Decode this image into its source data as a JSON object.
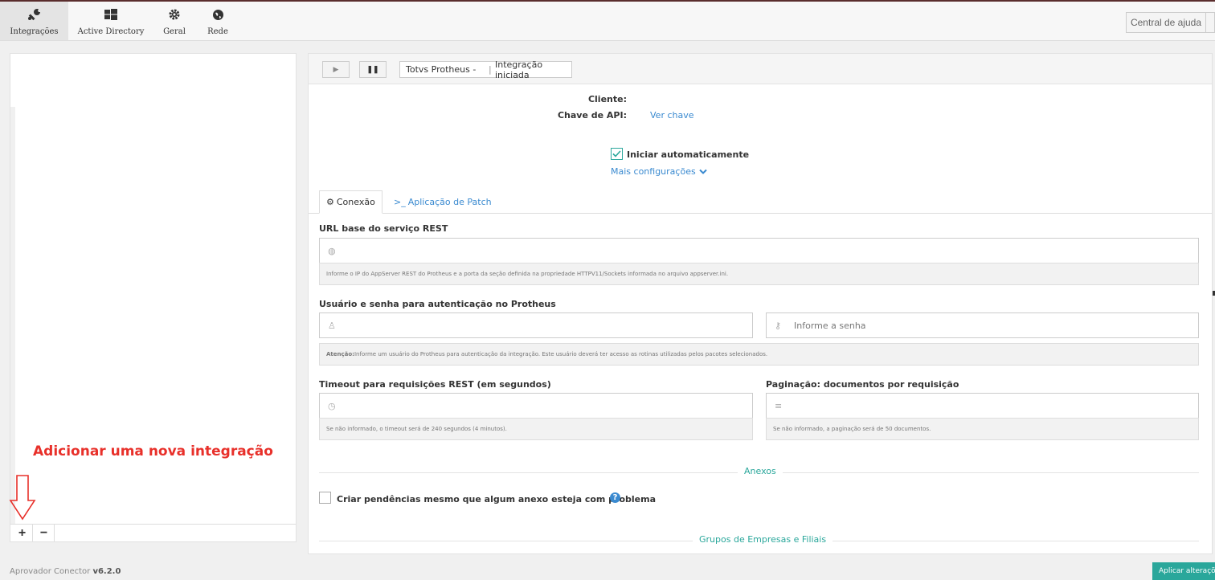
{
  "nav": {
    "tabs": [
      {
        "label": "Integrações",
        "icon": "wrench-icon"
      },
      {
        "label": "Active Directory",
        "icon": "windows-icon"
      },
      {
        "label": "Geral",
        "icon": "gear-icon"
      },
      {
        "label": "Rede",
        "icon": "globe-icon"
      }
    ],
    "active_tab": "Integrações",
    "help_label": "Central de ajuda"
  },
  "left_panel": {
    "annotation": "Adicionar uma nova integração",
    "add_label": "+",
    "remove_label": "−"
  },
  "toolbar": {
    "play_glyph": "▶",
    "pause_glyph": "❚❚",
    "integration_name": "Totvs Protheus -",
    "separator": "|",
    "status": "Integração iniciada"
  },
  "info": {
    "client_label": "Cliente:",
    "api_key_label": "Chave de API:",
    "api_key_link": "Ver chave",
    "auto_start_label": "Iniciar automaticamente",
    "more_settings": "Mais configurações"
  },
  "tabs": [
    {
      "label": "Conexão",
      "icon": "cogs-icon",
      "active": true
    },
    {
      "label": "Aplicação de Patch",
      "icon": "terminal-icon",
      "active": false
    }
  ],
  "form": {
    "url_title": "URL base do serviço REST",
    "url_hint": "Informe o IP do AppServer REST do Protheus e a porta da seção definida na propriedade HTTPV11/Sockets informada no arquivo appserver.ini.",
    "auth_title": "Usuário e senha para autenticação no Protheus",
    "password_placeholder": "Informe a senha",
    "auth_hint_bold": "Atenção:",
    "auth_hint": " Informe um usuário do Protheus para autenticação da integração. Este usuário deverá ter acesso as rotinas utilizadas pelos pacotes selecionados.",
    "timeout_title": "Timeout para requisições REST (em segundos)",
    "timeout_hint": "Se não informado, o timeout será de 240 segundos (4 minutos).",
    "paging_title": "Paginação: documentos por requisição",
    "paging_hint": "Se não informado, a paginação será de 50 documentos."
  },
  "sections": {
    "attachments": "Anexos",
    "attachments_checkbox": "Criar pendências mesmo que algum anexo esteja com problema",
    "groups": "Grupos de Empresas e Filiais"
  },
  "footer": {
    "app_name": "Aprovador Conector",
    "version": "v6.2.0",
    "apply_label": "Aplicar alterações"
  },
  "colors": {
    "accent": "#2aa79b",
    "link": "#3a8ad0",
    "annotation": "#e8302a"
  }
}
